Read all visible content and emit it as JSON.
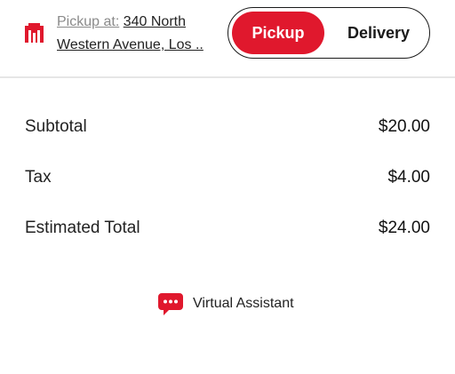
{
  "header": {
    "pickup_prefix": "Pickup at:",
    "pickup_address": "340 North Western Avenue, Los ..",
    "modes": {
      "pickup_label": "Pickup",
      "delivery_label": "Delivery",
      "selected": "Pickup"
    },
    "brand_icon": "brand-logo-icon"
  },
  "summary": {
    "subtotal_label": "Subtotal",
    "subtotal_value": "$20.00",
    "tax_label": "Tax",
    "tax_value": "$4.00",
    "total_label": "Estimated Total",
    "total_value": "$24.00"
  },
  "assistant": {
    "label": "Virtual Assistant",
    "icon": "chat-bubble-icon"
  },
  "colors": {
    "accent": "#e0182d",
    "text": "#1a1a1a",
    "muted": "#8a8a8a",
    "divider": "#e6e6e6"
  }
}
